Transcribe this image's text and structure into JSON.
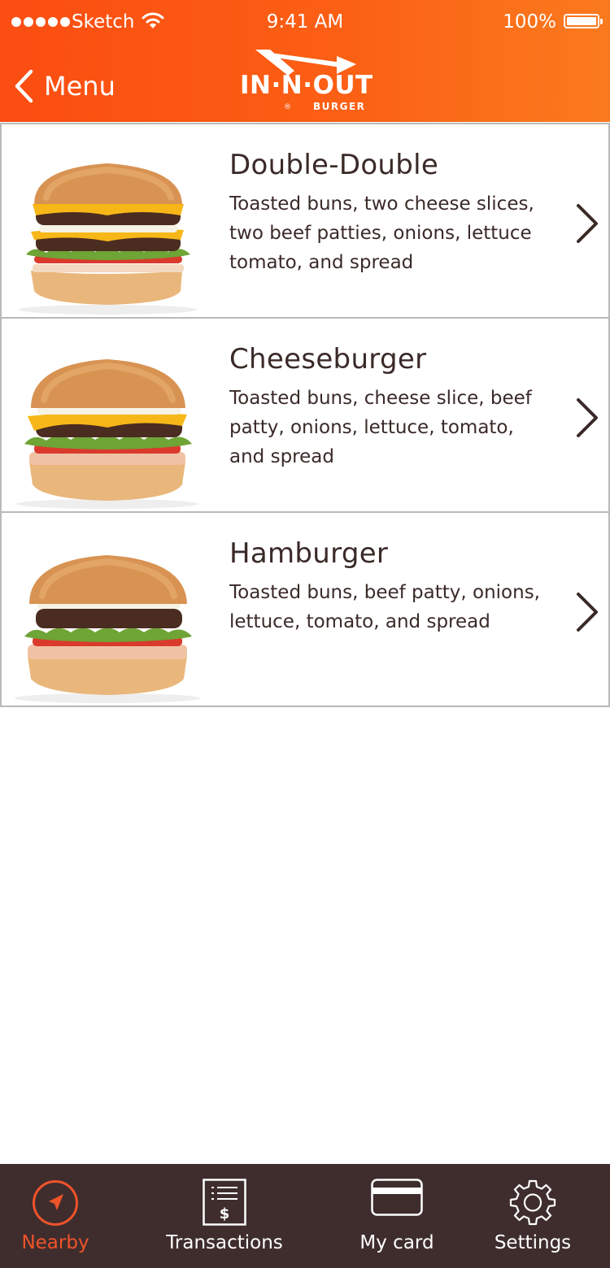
{
  "status_bar": {
    "carrier": "Sketch",
    "time": "9:41 AM",
    "battery": "100%"
  },
  "nav": {
    "back_label": "Menu",
    "logo_text": "IN·N·OUT",
    "logo_sub": "BURGER",
    "logo_reg": "®"
  },
  "colors": {
    "header_gradient": [
      "#fb4d12",
      "#fb7a1e"
    ],
    "tab_bar": "#3f2d2d",
    "active_tab": "#f0532a",
    "text": "#3a2a28"
  },
  "items": [
    {
      "title": "Double-Double",
      "description": "Toasted buns, two cheese slices, two beef patties, onions, lettuce tomato, and spread",
      "icon": "chevron-right-icon"
    },
    {
      "title": "Cheeseburger",
      "description": "Toasted buns, cheese slice, beef patty, onions, lettuce, tomato, and spread",
      "icon": "chevron-right-icon"
    },
    {
      "title": "Hamburger",
      "description": "Toasted buns, beef patty, onions, lettuce, tomato, and spread",
      "icon": "chevron-right-icon"
    }
  ],
  "tabs": [
    {
      "label": "Nearby",
      "icon": "location-arrow-icon",
      "active": true
    },
    {
      "label": "Transactions",
      "icon": "receipt-icon",
      "active": false
    },
    {
      "label": "My card",
      "icon": "card-icon",
      "active": false
    },
    {
      "label": "Settings",
      "icon": "gear-icon",
      "active": false
    }
  ]
}
